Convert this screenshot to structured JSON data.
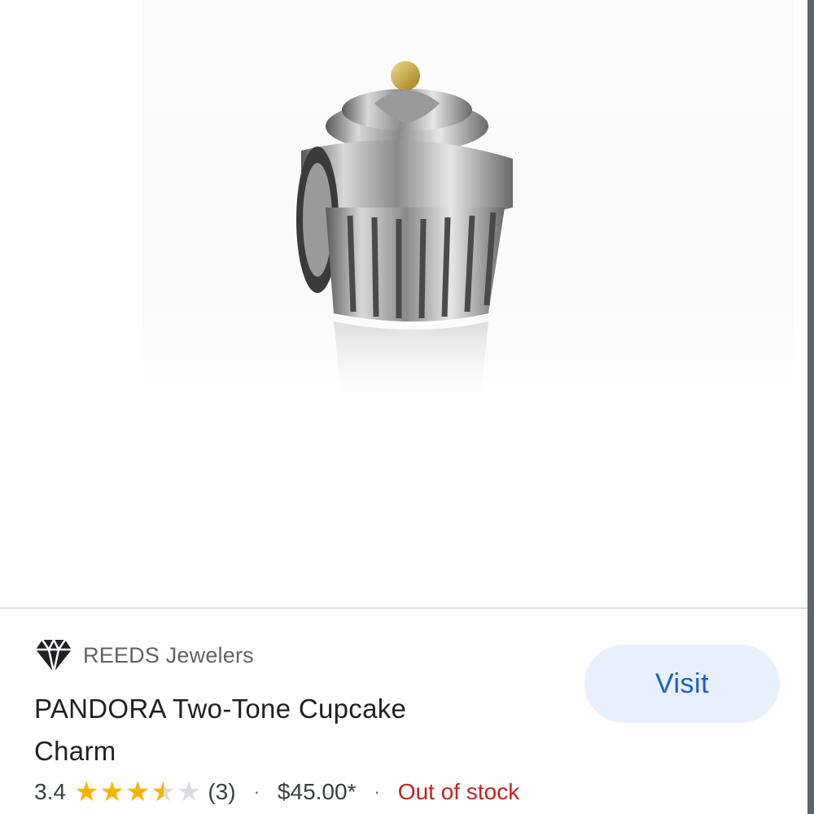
{
  "merchant": {
    "name": "REEDS Jewelers",
    "icon": "diamond-icon"
  },
  "product": {
    "title_line1": "PANDORA Two-Tone Cupcake",
    "title_line2": "Charm",
    "rating": "3.4",
    "rating_value": 3.4,
    "rating_max": 5,
    "review_count": "(3)",
    "price": "$45.00*",
    "availability": "Out of stock",
    "image_icon": "cupcake-charm-image"
  },
  "actions": {
    "visit_label": "Visit"
  },
  "colors": {
    "accent": "#1a5fd0",
    "button_bg": "#e8f0fe",
    "star": "#f6b400",
    "out_of_stock": "#c5221f"
  },
  "separators": {
    "dot": "·"
  }
}
